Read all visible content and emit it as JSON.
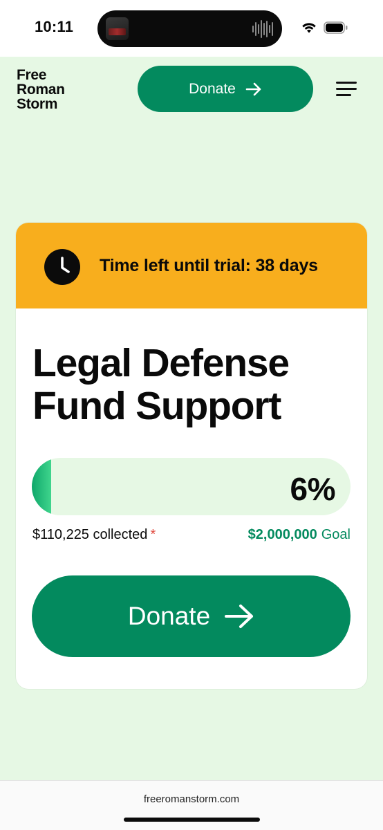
{
  "status_bar": {
    "time": "10:11"
  },
  "header": {
    "logo_lines": [
      "Free",
      "Roman",
      "Storm"
    ],
    "donate_label": "Donate",
    "menu_icon": "hamburger-menu-icon"
  },
  "card": {
    "timer_text": "Time left until trial: 38 days",
    "clock_icon": "clock-icon",
    "title": "Legal Defense Fund Support",
    "progress": {
      "percent_label": "6%",
      "fraction": 0.06
    },
    "collected_text": "$110,225 collected",
    "asterisk": "*",
    "goal_amount": "$2,000,000",
    "goal_label": "Goal",
    "donate_label": "Donate"
  },
  "browser": {
    "url": "freeromanstorm.com"
  },
  "colors": {
    "background": "#e6f8e4",
    "accent_green": "#038a5e",
    "timer_yellow": "#f8ae1d",
    "asterisk_red": "#e04a3f"
  }
}
